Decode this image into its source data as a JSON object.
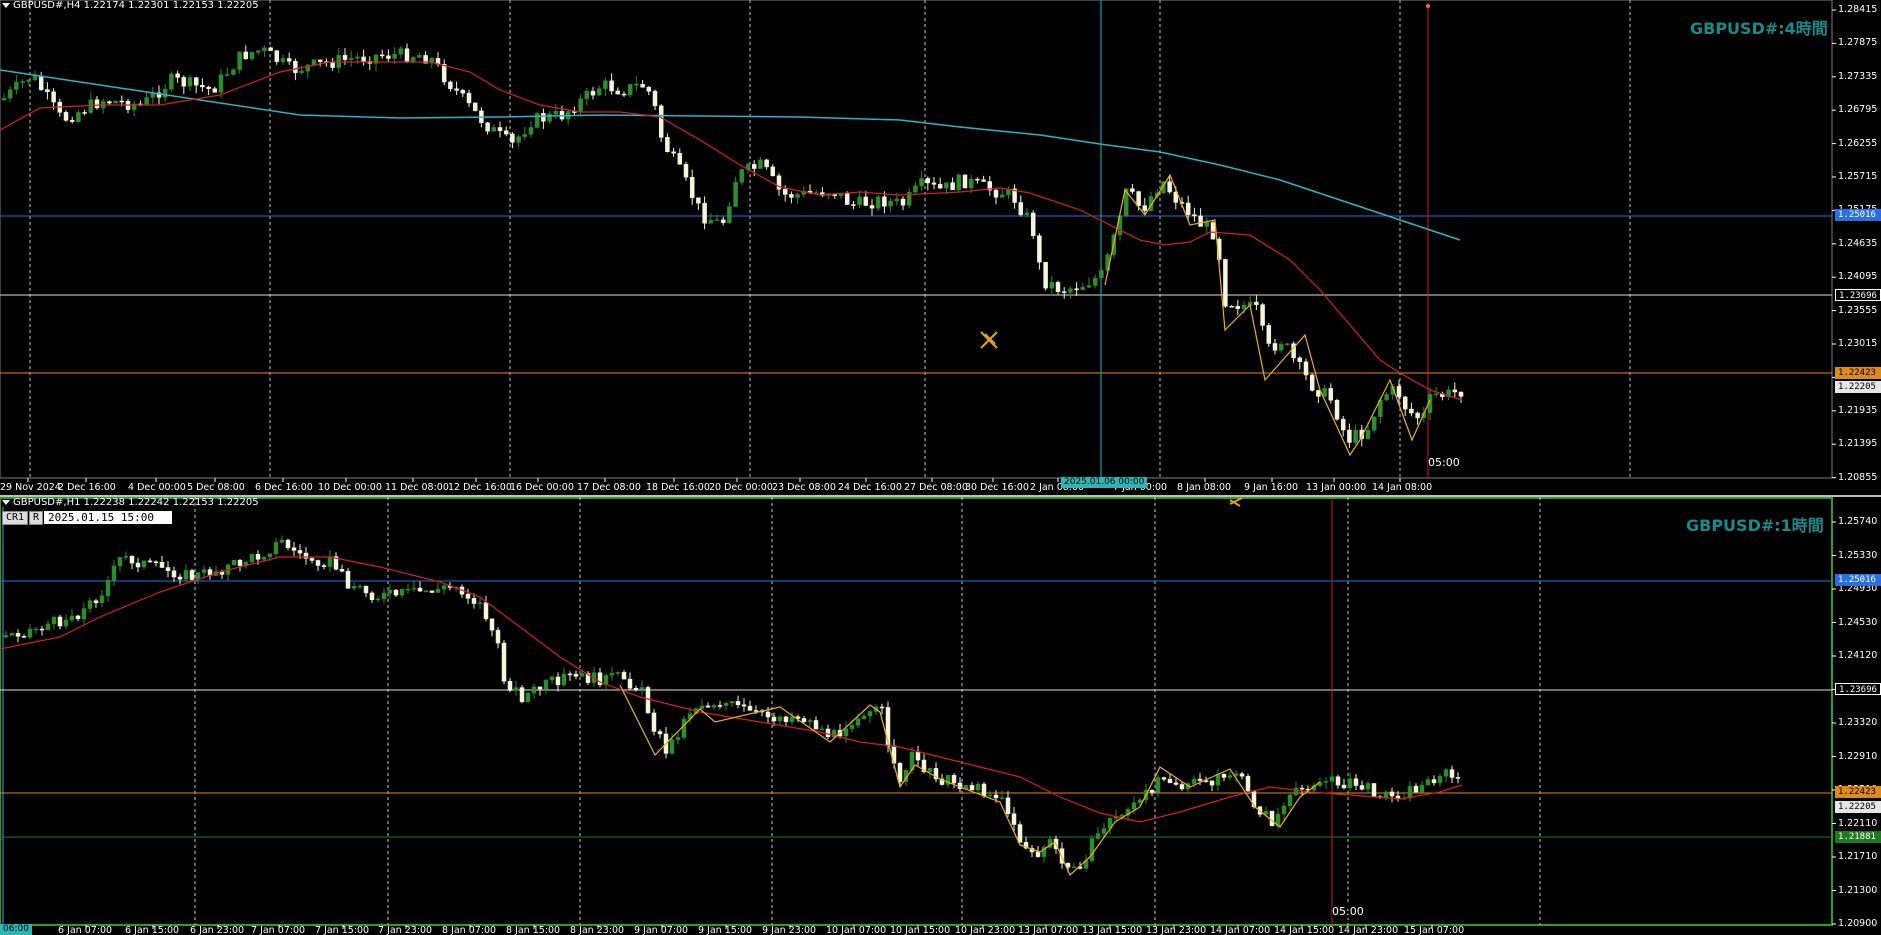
{
  "top": {
    "infobar": "GBPUSD#,H4  1.22174 1.22301 1.22153 1.22205",
    "title": "GBPUSD#:4時間",
    "y_labels": [
      "1.28415",
      "1.27875",
      "1.27335",
      "1.26795",
      "1.26255",
      "1.25715",
      "1.25175",
      "1.24635",
      "1.24095",
      "1.23555",
      "1.23015",
      "1.22475",
      "1.21935",
      "1.21395",
      "1.20855"
    ],
    "price_tags": {
      "blue": "1.25016",
      "white": "1.23696",
      "orange": "1.22423",
      "bid": "1.22205"
    },
    "x_labels": [
      "29 Nov 2024",
      "2 Dec 16:00",
      "4 Dec 00:00",
      "5 Dec 08:00",
      "6 Dec 16:00",
      "10 Dec 00:00",
      "11 Dec 08:00",
      "12 Dec 16:00",
      "16 Dec 00:00",
      "17 Dec 08:00",
      "18 Dec 16:00",
      "20 Dec 00:00",
      "23 Dec 08:00",
      "24 Dec 16:00",
      "27 Dec 08:00",
      "30 Dec 16:00",
      "2 Jan 08:00",
      "7 Jan 00:00",
      "8 Jan 08:00",
      "9 Jan 16:00",
      "13 Jan 00:00",
      "14 Jan 08:00"
    ],
    "selected_time": "2025.01.06 00:00",
    "now_label": "05:00"
  },
  "bottom": {
    "infobar": "GBPUSD#,H1  1.22238 1.22242 1.22153 1.22205",
    "title": "GBPUSD#:1時間",
    "cr_label": "CR1",
    "r_label": "R",
    "date_input": "2025.01.15 15:00",
    "y_labels": [
      "1.25740",
      "1.25330",
      "1.24930",
      "1.24530",
      "1.24120",
      "1.23710",
      "1.23320",
      "1.22910",
      "1.22510",
      "1.22110",
      "1.21710",
      "1.21300",
      "1.20900"
    ],
    "price_tags": {
      "blue": "1.25016",
      "white": "1.23696",
      "orange": "1.22423",
      "bid": "1.22205",
      "green": "1.21881"
    },
    "x_labels": [
      "06:00",
      "6 Jan 07:00",
      "6 Jan 15:00",
      "6 Jan 23:00",
      "7 Jan 07:00",
      "7 Jan 15:00",
      "7 Jan 23:00",
      "8 Jan 07:00",
      "8 Jan 15:00",
      "8 Jan 23:00",
      "9 Jan 07:00",
      "9 Jan 15:00",
      "9 Jan 23:00",
      "10 Jan 07:00",
      "10 Jan 15:00",
      "10 Jan 23:00",
      "13 Jan 07:00",
      "13 Jan 15:00",
      "13 Jan 23:00",
      "14 Jan 07:00",
      "14 Jan 15:00",
      "14 Jan 23:00",
      "15 Jan 07:00"
    ],
    "now_label": "05:00"
  },
  "colors": {
    "background": "#000000",
    "bull": "#2e8b2e",
    "bear": "#f5f5dc",
    "ma_fast": "#d32020",
    "ma_slow": "#2ab5c0",
    "zigzag": "#e8b020",
    "level_blue": "#2a6fe0",
    "level_orange": "#e08a1a",
    "level_green": "#1f7a1f",
    "title": "#1a8a8a"
  },
  "icons": {
    "crosshair": "crosshair-cursor-icon"
  }
}
